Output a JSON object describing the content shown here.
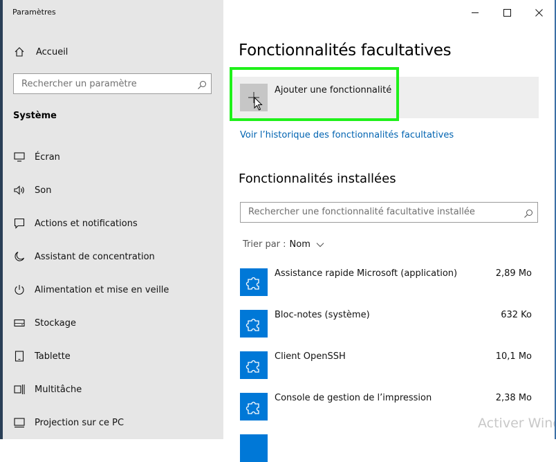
{
  "window": {
    "title": "Paramètres",
    "controls": {
      "minimize": "minimize-icon",
      "maximize": "maximize-icon",
      "close": "close-icon"
    }
  },
  "sidebar": {
    "home_label": "Accueil",
    "search_placeholder": "Rechercher un paramètre",
    "section_title": "Système",
    "items": [
      {
        "label": "Écran",
        "icon": "display-icon"
      },
      {
        "label": "Son",
        "icon": "sound-icon"
      },
      {
        "label": "Actions et notifications",
        "icon": "notifications-icon"
      },
      {
        "label": "Assistant de concentration",
        "icon": "moon-icon"
      },
      {
        "label": "Alimentation et mise en veille",
        "icon": "power-icon"
      },
      {
        "label": "Stockage",
        "icon": "storage-icon"
      },
      {
        "label": "Tablette",
        "icon": "tablet-icon"
      },
      {
        "label": "Multitâche",
        "icon": "multitask-icon"
      },
      {
        "label": "Projection sur ce PC",
        "icon": "projection-icon"
      }
    ]
  },
  "main": {
    "title": "Fonctionnalités facultatives",
    "add_feature_label": "Ajouter une fonctionnalité",
    "history_link": "Voir l’historique des fonctionnalités facultatives",
    "installed_title": "Fonctionnalités installées",
    "installed_search_placeholder": "Rechercher une fonctionnalité facultative installée",
    "sort_prefix": "Trier par :",
    "sort_value": "Nom",
    "features": [
      {
        "name": "Assistance rapide Microsoft (application)",
        "size": "2,89 Mo"
      },
      {
        "name": "Bloc-notes (système)",
        "size": "632 Ko"
      },
      {
        "name": "Client OpenSSH",
        "size": "10,1 Mo"
      },
      {
        "name": "Console de gestion de l’impression",
        "size": "2,38 Mo"
      }
    ]
  },
  "watermark": "Activer Wind",
  "colors": {
    "accent": "#0078d7",
    "link": "#0063b1",
    "highlight": "#1ff11a",
    "sidebar_bg": "#e6e6e6"
  }
}
